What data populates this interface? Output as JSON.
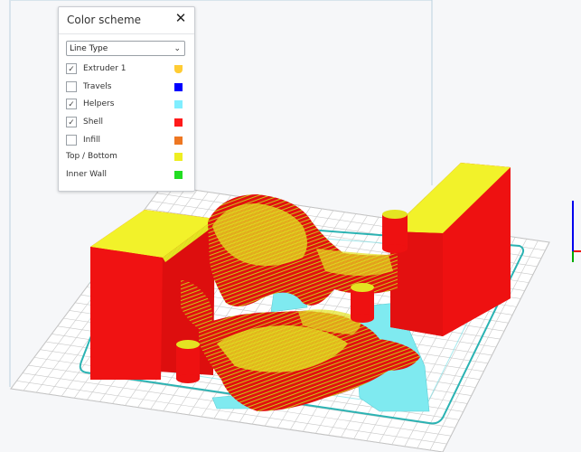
{
  "panel": {
    "title": "Color scheme",
    "close_glyph": "✕",
    "select_value": "Line Type",
    "chevron_glyph": "⌄",
    "items": [
      {
        "label": "Extruder 1",
        "has_checkbox": true,
        "checked": true,
        "color": "#ffcc33",
        "swatch_shape": "rounded"
      },
      {
        "label": "Travels",
        "has_checkbox": true,
        "checked": false,
        "color": "#0000ff"
      },
      {
        "label": "Helpers",
        "has_checkbox": true,
        "checked": true,
        "color": "#80eeff"
      },
      {
        "label": "Shell",
        "has_checkbox": true,
        "checked": true,
        "color": "#ff1a1a"
      },
      {
        "label": "Infill",
        "has_checkbox": true,
        "checked": false,
        "color": "#ee7722"
      },
      {
        "label": "Top / Bottom",
        "has_checkbox": false,
        "color": "#eeee22"
      },
      {
        "label": "Inner Wall",
        "has_checkbox": false,
        "color": "#22dd22"
      }
    ],
    "check_glyph": "✓"
  },
  "scene": {
    "background": "#f6f7f9",
    "bed_color": "#ffffff",
    "grid_color": "#c8c8c8",
    "shell_color": "#ee1111",
    "top_color": "#f2f22a",
    "helper_color": "#7feaf0",
    "skirt_color": "#2bb3b3",
    "axis_x_color": "#ee0000",
    "axis_y_color": "#00aa00",
    "axis_z_color": "#0000ee"
  }
}
